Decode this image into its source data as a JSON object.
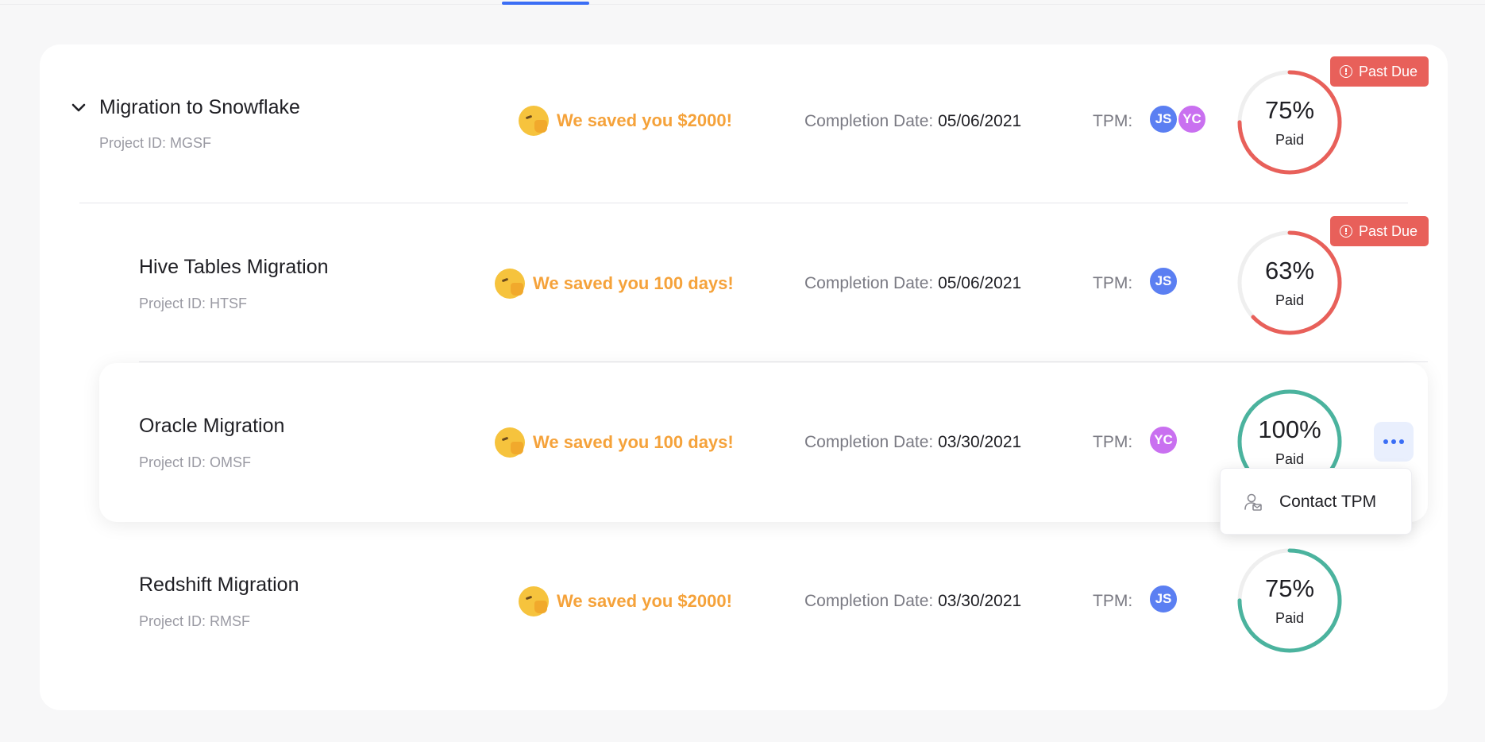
{
  "colors": {
    "accent": "#3b6ef5",
    "saved_text": "#f5a23a",
    "past_due": "#e8605a",
    "progress_incomplete": "#e8605a",
    "progress_complete": "#4bb39e",
    "avatar_js": "#5b7ff2",
    "avatar_yc": "#c970f0"
  },
  "labels": {
    "project_id_prefix": "Project ID:",
    "completion_date_label": "Completion Date:",
    "tpm_label": "TPM:",
    "paid_label": "Paid",
    "past_due_label": "Past Due"
  },
  "projects": [
    {
      "name": "Migration to Snowflake",
      "id": "MGSF",
      "saved": "We saved you $2000!",
      "completion_date": "05/06/2021",
      "tpms": [
        "JS",
        "YC"
      ],
      "paid_percent": 75,
      "paid_text": "75%",
      "status": "Past Due",
      "expanded": true,
      "icons": {
        "chevron": "chevron-down-icon",
        "emoji": "winking-thumbs-up-emoji-icon"
      }
    },
    {
      "name": "Hive Tables Migration",
      "id": "HTSF",
      "saved": "We saved you 100 days!",
      "completion_date": "05/06/2021",
      "tpms": [
        "JS"
      ],
      "paid_percent": 63,
      "paid_text": "63%",
      "status": "Past Due"
    },
    {
      "name": "Oracle Migration",
      "id": "OMSF",
      "saved": "We saved you 100 days!",
      "completion_date": "03/30/2021",
      "tpms": [
        "YC"
      ],
      "paid_percent": 100,
      "paid_text": "100%",
      "status": "",
      "hovered": true
    },
    {
      "name": "Redshift Migration",
      "id": "RMSF",
      "saved": "We saved you $2000!",
      "completion_date": "03/30/2021",
      "tpms": [
        "JS"
      ],
      "paid_percent": 75,
      "paid_text": "75%",
      "status": ""
    }
  ],
  "context_menu": {
    "items": [
      {
        "label": "Contact TPM",
        "icon": "contact-person-icon"
      }
    ]
  }
}
